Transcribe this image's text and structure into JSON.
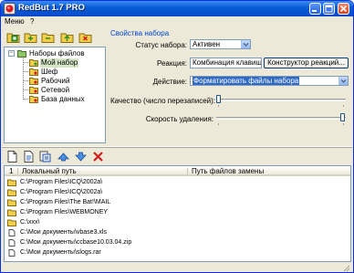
{
  "window": {
    "title": "RedBut 1.7 PRO"
  },
  "menu": [
    "Меню",
    "?"
  ],
  "tree": {
    "toolbar_icons": [
      "add-set-icon",
      "folder-add-icon",
      "folder-remove-icon",
      "folder-up-icon",
      "folder-delete-icon"
    ],
    "root": {
      "label": "Наборы файлов",
      "expander": "−"
    },
    "items": [
      {
        "label": "Мой набор",
        "selected": true
      },
      {
        "label": "Шеф",
        "selected": false
      },
      {
        "label": "Рабочий",
        "selected": false
      },
      {
        "label": "Сетевой",
        "selected": false
      },
      {
        "label": "База данных",
        "selected": false
      }
    ]
  },
  "settings": {
    "title": "Свойства набора",
    "status_label": "Статус набора:",
    "status_value": "Активен",
    "reaction_label": "Реакция:",
    "reaction_value": "Комбинация клавиш +",
    "reaction_button": "Конструктор реакций...",
    "action_label": "Действие:",
    "action_value": "Форматировать файлы набора",
    "quality_label": "Качество (число перезаписей):",
    "quality_level": 0,
    "speed_label": "Скорость удаления:",
    "speed_level": 1
  },
  "bottom_toolbar_icons": [
    "new-file-icon",
    "open-file-icon",
    "properties-icon",
    "move-up-icon",
    "move-down-icon",
    "delete-icon"
  ],
  "list": {
    "columns": [
      "1",
      "Локальный путь",
      "Путь файлов замены"
    ],
    "rows": [
      {
        "icon": "folder-icon",
        "path": "C:\\Program Files\\ICQ\\2002a\\"
      },
      {
        "icon": "folder-icon",
        "path": "C:\\Program Files\\ICQ\\2002a\\"
      },
      {
        "icon": "folder-icon",
        "path": "C:\\Program Files\\The Bat!\\MAIL"
      },
      {
        "icon": "folder-icon",
        "path": "C:\\Program Files\\WEBMONEY"
      },
      {
        "icon": "folder-icon",
        "path": "C:\\xxx\\"
      },
      {
        "icon": "file-icon",
        "path": "C:\\Мои документы\\vbase3.xls"
      },
      {
        "icon": "file-icon",
        "path": "C:\\Мои документы\\ccbase10.03.04.zip"
      },
      {
        "icon": "file-icon",
        "path": "C:\\Мои документы\\slogs.rar"
      }
    ]
  },
  "colors": {
    "title_bar": "#0a5fd8",
    "accent_text": "#0046d5",
    "selection": "#316ac5",
    "folder": "#f2cf4a"
  }
}
